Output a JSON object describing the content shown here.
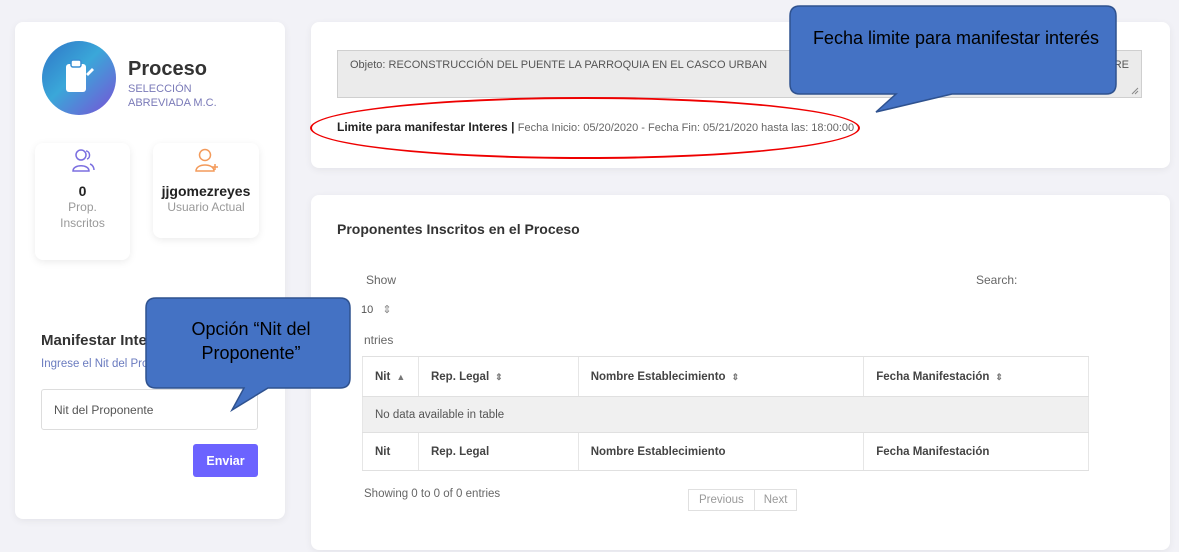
{
  "process": {
    "title": "Proceso",
    "subtitle": "SELECCIÓN ABREVIADA M.C."
  },
  "stats": {
    "proponents_count": "0",
    "proponents_label": "Prop. Inscritos",
    "user_name": "jjgomezreyes",
    "user_label": "Usuario Actual"
  },
  "manifest": {
    "title": "Manifestar Intere",
    "instruction": "Ingrese el Nit del Prop",
    "input_placeholder": "Nit del Proponente",
    "submit_label": "Enviar"
  },
  "objeto": {
    "text": "Objeto: RECONSTRUCCIÓN DEL PUENTE LA PARROQUIA EN EL CASCO URBAN",
    "text_tail": "RE"
  },
  "limit": {
    "label": "Limite para manifestar Interes",
    "separator": "|",
    "detail": "Fecha Inicio: 05/20/2020 - Fecha Fin: 05/21/2020 hasta las: 18:00:00"
  },
  "table_section": {
    "title": "Proponentes Inscritos en el Proceso",
    "show_label": "Show",
    "length_value": "10",
    "entries_label": "ntries",
    "search_label": "Search:",
    "columns": [
      "Nit",
      "Rep. Legal",
      "Nombre Establecimiento",
      "Fecha Manifestación"
    ],
    "empty_message": "No data available in table",
    "info": "Showing 0 to 0 of 0 entries",
    "prev_label": "Previous",
    "next_label": "Next"
  },
  "annotations": {
    "fecha_callout": "Fecha limite para manifestar interés",
    "nit_callout": "Opción “Nit del Proponente”",
    "callout_fill": "#4472c4",
    "ellipse_color": "#e00000"
  },
  "colors": {
    "accent": "#6c63ff",
    "background": "#f2f2f7"
  }
}
